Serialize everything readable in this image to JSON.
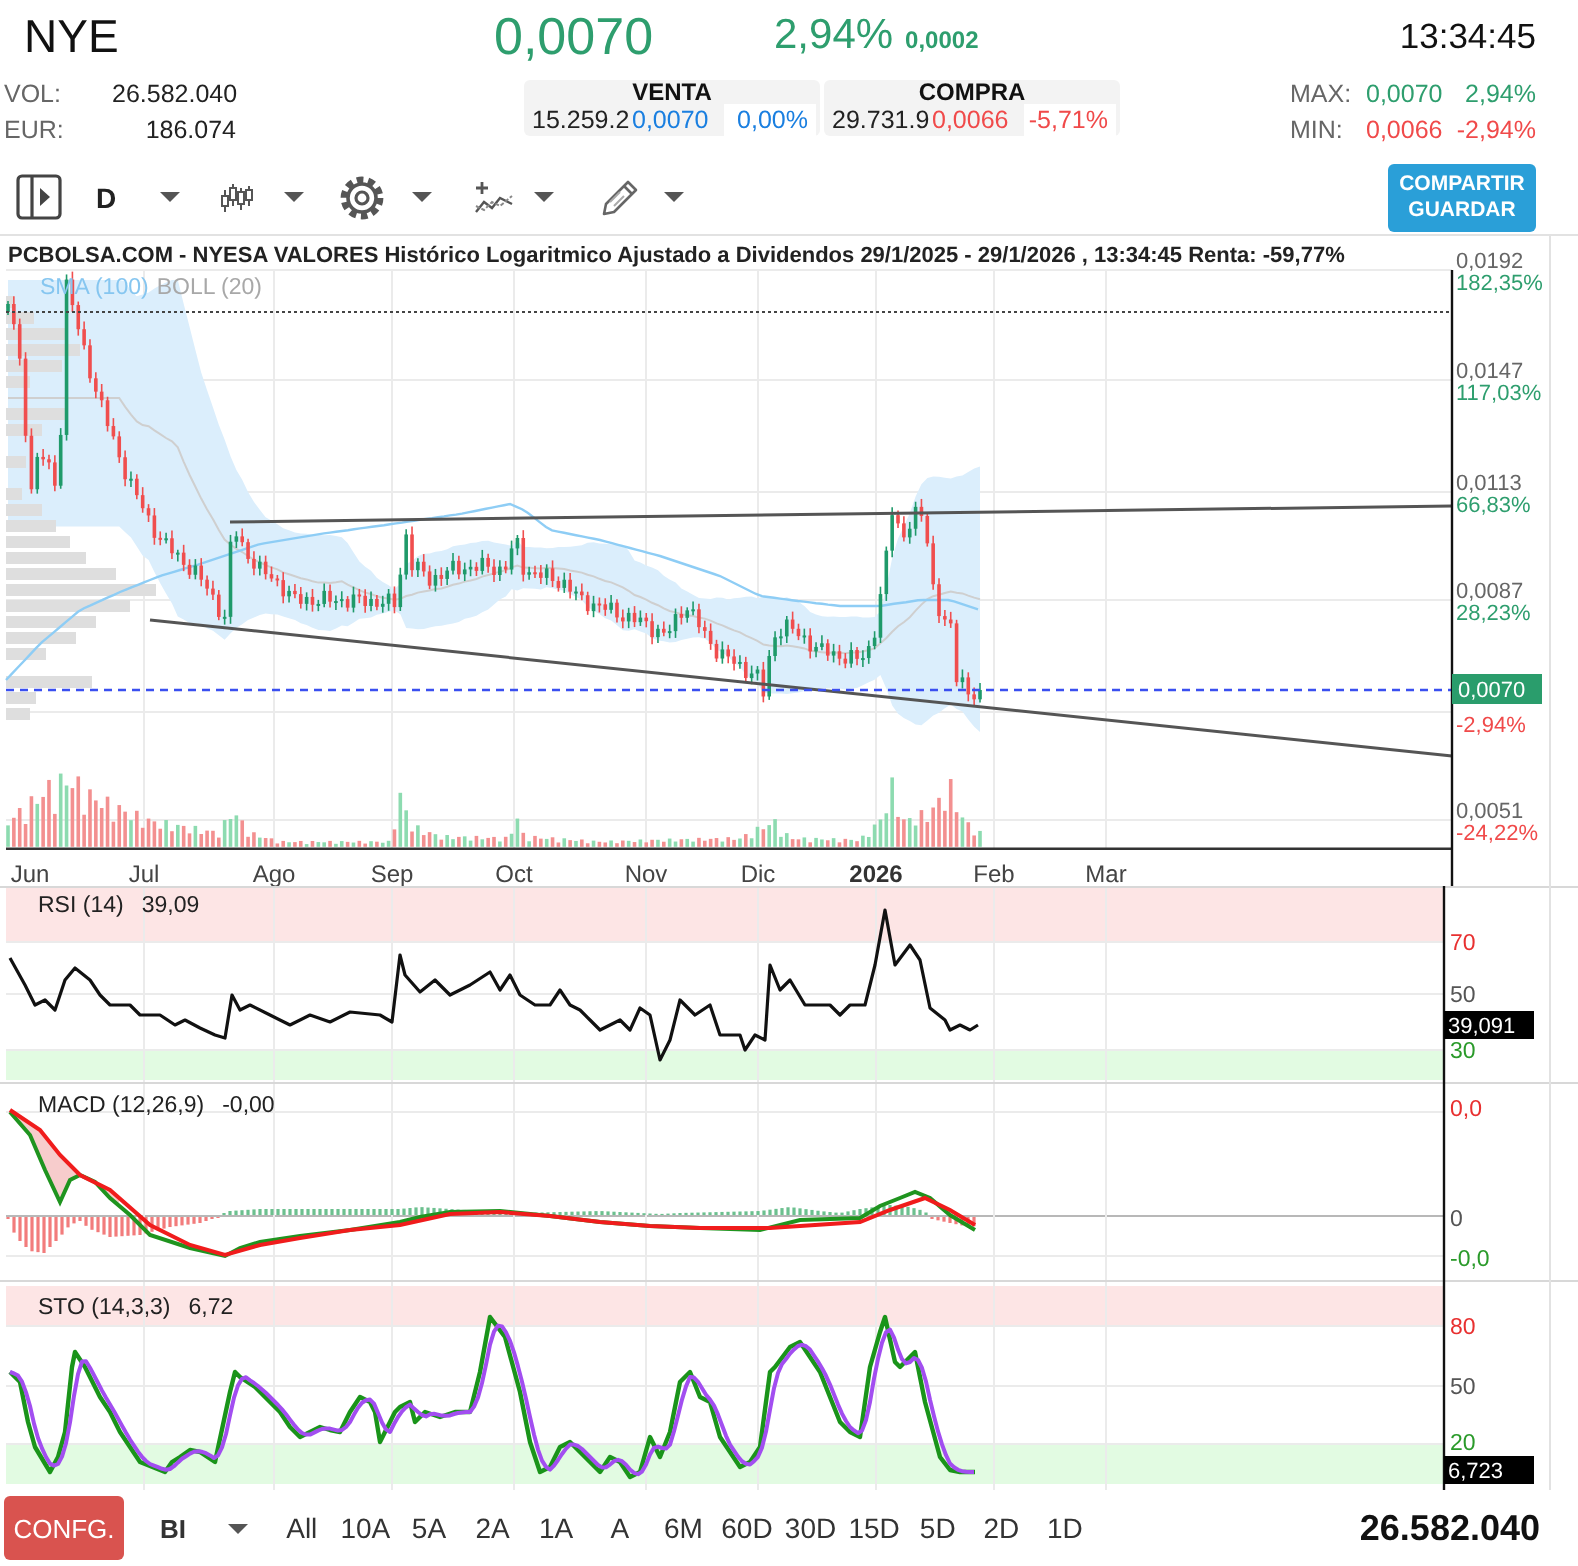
{
  "header": {
    "symbol": "NYE",
    "price": "0,0070",
    "kind": "up",
    "change_percent": "2,94%",
    "change": "0,0002",
    "time": "13:34:45"
  },
  "stats": [
    {
      "label": "VOL:",
      "value": "26.582.040"
    },
    {
      "label": "EUR:",
      "value": "186.074"
    }
  ],
  "quotes": [
    {
      "title": "VENTA",
      "volume": "15.259.2",
      "price": "0,0070",
      "percent": "0,00%",
      "kind": "flat"
    },
    {
      "title": "COMPRA",
      "volume": "29.731.9",
      "price": "0,0066",
      "percent": "-5,71%",
      "kind": "down"
    }
  ],
  "day_range": [
    {
      "label": "MAX:",
      "price": "0,0070",
      "percent": "2,94%",
      "kind": "up"
    },
    {
      "label": "MIN:",
      "price": "0,0066",
      "percent": "-2,94%",
      "kind": "down"
    }
  ],
  "toolbar": {
    "period": "D",
    "share_button": "COMPARTIR GUARDAR"
  },
  "chart": {
    "title": "PCBOLSA.COM - NYESA VALORES Histórico Logaritmico Ajustado a Dividendos 29/1/2025 - 29/1/2026 , 13:34:45 Renta: -59,77%",
    "overlays": [
      {
        "label": "SMA (100)",
        "kind": "sma"
      },
      {
        "label": "BOLL (20)",
        "kind": "boll"
      }
    ],
    "price_axis": [
      {
        "price": "0,0192",
        "change": "182,35%",
        "kind": "up"
      },
      {
        "price": "0,0147",
        "change": "117,03%",
        "kind": "up"
      },
      {
        "price": "0,0113",
        "change": "66,83%",
        "kind": "up"
      },
      {
        "price": "0,0087",
        "change": "28,23%",
        "kind": "up"
      },
      {
        "change": "-2,94%",
        "kind": "down"
      },
      {
        "price": "0,0051",
        "change": "-24,22%",
        "kind": "down"
      }
    ],
    "current_price": "0,0070",
    "time_axis": [
      {
        "label": "Jun",
        "kind": "month"
      },
      {
        "label": "Jul",
        "kind": "month"
      },
      {
        "label": "Ago",
        "kind": "month"
      },
      {
        "label": "Sep",
        "kind": "month"
      },
      {
        "label": "Oct",
        "kind": "month"
      },
      {
        "label": "Nov",
        "kind": "month"
      },
      {
        "label": "Dic",
        "kind": "month"
      },
      {
        "label": "2026",
        "kind": "year"
      },
      {
        "label": "Feb",
        "kind": "month"
      },
      {
        "label": "Mar",
        "kind": "month"
      }
    ]
  },
  "rsi": {
    "label": "RSI (14)",
    "value": "39,09",
    "levels": [
      {
        "label": "70",
        "kind": "high"
      },
      {
        "label": "50",
        "kind": "mid"
      },
      {
        "label": "30",
        "kind": "low"
      }
    ],
    "current": "39,091"
  },
  "macd": {
    "label": "MACD (12,26,9)",
    "value": "-0,00",
    "levels": [
      {
        "label": "0,0",
        "kind": "high"
      },
      {
        "label": "0",
        "kind": "mid"
      },
      {
        "label": "-0,0",
        "kind": "low"
      }
    ]
  },
  "sto": {
    "label": "STO (14,3,3)",
    "value": "6,72",
    "levels": [
      {
        "label": "80",
        "kind": "high"
      },
      {
        "label": "50",
        "kind": "mid"
      },
      {
        "label": "20",
        "kind": "low"
      }
    ],
    "current": "6,723"
  },
  "bottom_bar": {
    "config_button": "CONFG.",
    "mode": "BI",
    "ranges": [
      {
        "label": "All",
        "selected": false
      },
      {
        "label": "10A",
        "selected": false
      },
      {
        "label": "5A",
        "selected": false
      },
      {
        "label": "2A",
        "selected": false
      },
      {
        "label": "1A",
        "selected": false
      },
      {
        "label": "A",
        "selected": false
      },
      {
        "label": "6M",
        "selected": false
      },
      {
        "label": "60D",
        "selected": false
      },
      {
        "label": "30D",
        "selected": false
      },
      {
        "label": "15D",
        "selected": false
      },
      {
        "label": "5D",
        "selected": false
      },
      {
        "label": "2D",
        "selected": false
      },
      {
        "label": "1D",
        "selected": false
      }
    ],
    "volume": "26.582.040"
  }
}
